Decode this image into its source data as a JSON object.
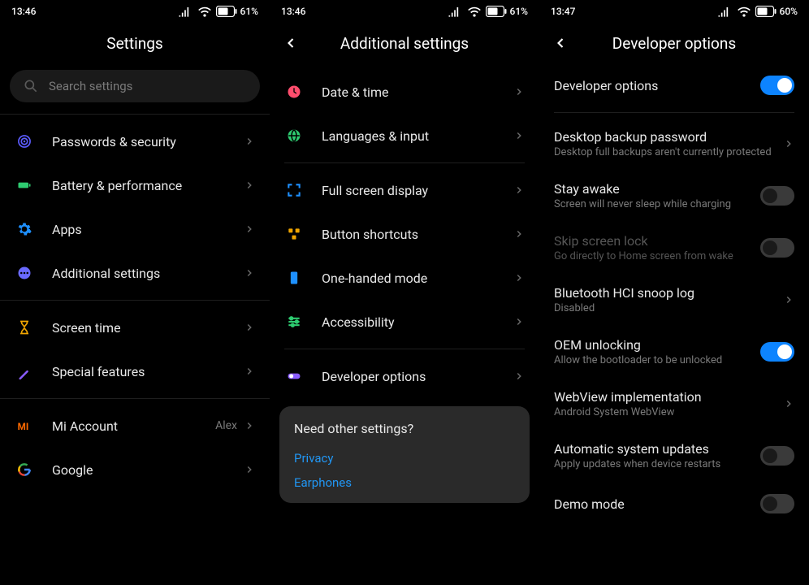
{
  "screen1": {
    "status": {
      "time": "13:46",
      "battery": "61"
    },
    "title": "Settings",
    "search_placeholder": "Search settings",
    "items": [
      {
        "label": "Passwords & security",
        "icon": "shield-icon",
        "color": "#5c5cff"
      },
      {
        "label": "Battery & performance",
        "icon": "battery-icon",
        "color": "#2ecc71"
      },
      {
        "label": "Apps",
        "icon": "gear-icon",
        "color": "#1e90ff"
      },
      {
        "label": "Additional settings",
        "icon": "dots-icon",
        "color": "#6a6aff"
      }
    ],
    "items2": [
      {
        "label": "Screen time",
        "icon": "hourglass-icon",
        "color": "#f0a500"
      },
      {
        "label": "Special features",
        "icon": "wand-icon",
        "color": "#8a5cff"
      }
    ],
    "items3": [
      {
        "label": "Mi Account",
        "icon": "mi-icon",
        "color": "#ff6a00",
        "right": "Alex"
      },
      {
        "label": "Google",
        "icon": "google-icon",
        "color": ""
      }
    ]
  },
  "screen2": {
    "status": {
      "time": "13:46",
      "battery": "61"
    },
    "title": "Additional settings",
    "group1": [
      {
        "label": "Date & time",
        "icon": "clock-icon",
        "color": "#ff4d6d"
      },
      {
        "label": "Languages & input",
        "icon": "globe-icon",
        "color": "#2ecc71"
      }
    ],
    "group2": [
      {
        "label": "Full screen display",
        "icon": "fullscreen-icon",
        "color": "#1e90ff"
      },
      {
        "label": "Button shortcuts",
        "icon": "shortcuts-icon",
        "color": "#f0a500"
      },
      {
        "label": "One-handed mode",
        "icon": "phone-icon",
        "color": "#1e90ff"
      },
      {
        "label": "Accessibility",
        "icon": "sliders-icon",
        "color": "#2ecc71"
      }
    ],
    "group3": [
      {
        "label": "Developer options",
        "icon": "toggle-icon",
        "color": "#8a5cff"
      }
    ],
    "card": {
      "title": "Need other settings?",
      "links": [
        "Privacy",
        "Earphones"
      ]
    }
  },
  "screen3": {
    "status": {
      "time": "13:47",
      "battery": "60"
    },
    "title": "Developer options",
    "items": [
      {
        "type": "toggle_row",
        "label": "Developer options",
        "on": true
      },
      {
        "type": "nav",
        "label": "Desktop backup password",
        "sub": "Desktop full backups aren't currently protected"
      },
      {
        "type": "toggle",
        "label": "Stay awake",
        "sub": "Screen will never sleep while charging",
        "on": false
      },
      {
        "type": "toggle",
        "label": "Skip screen lock",
        "sub": "Go directly to Home screen from wake",
        "on": false,
        "disabled": true
      },
      {
        "type": "nav",
        "label": "Bluetooth HCI snoop log",
        "sub": "Disabled"
      },
      {
        "type": "toggle",
        "label": "OEM unlocking",
        "sub": "Allow the bootloader to be unlocked",
        "on": true
      },
      {
        "type": "nav",
        "label": "WebView implementation",
        "sub": "Android System WebView"
      },
      {
        "type": "toggle",
        "label": "Automatic system updates",
        "sub": "Apply updates when device restarts",
        "on": false
      },
      {
        "type": "toggle",
        "label": "Demo mode",
        "on": false
      }
    ]
  }
}
